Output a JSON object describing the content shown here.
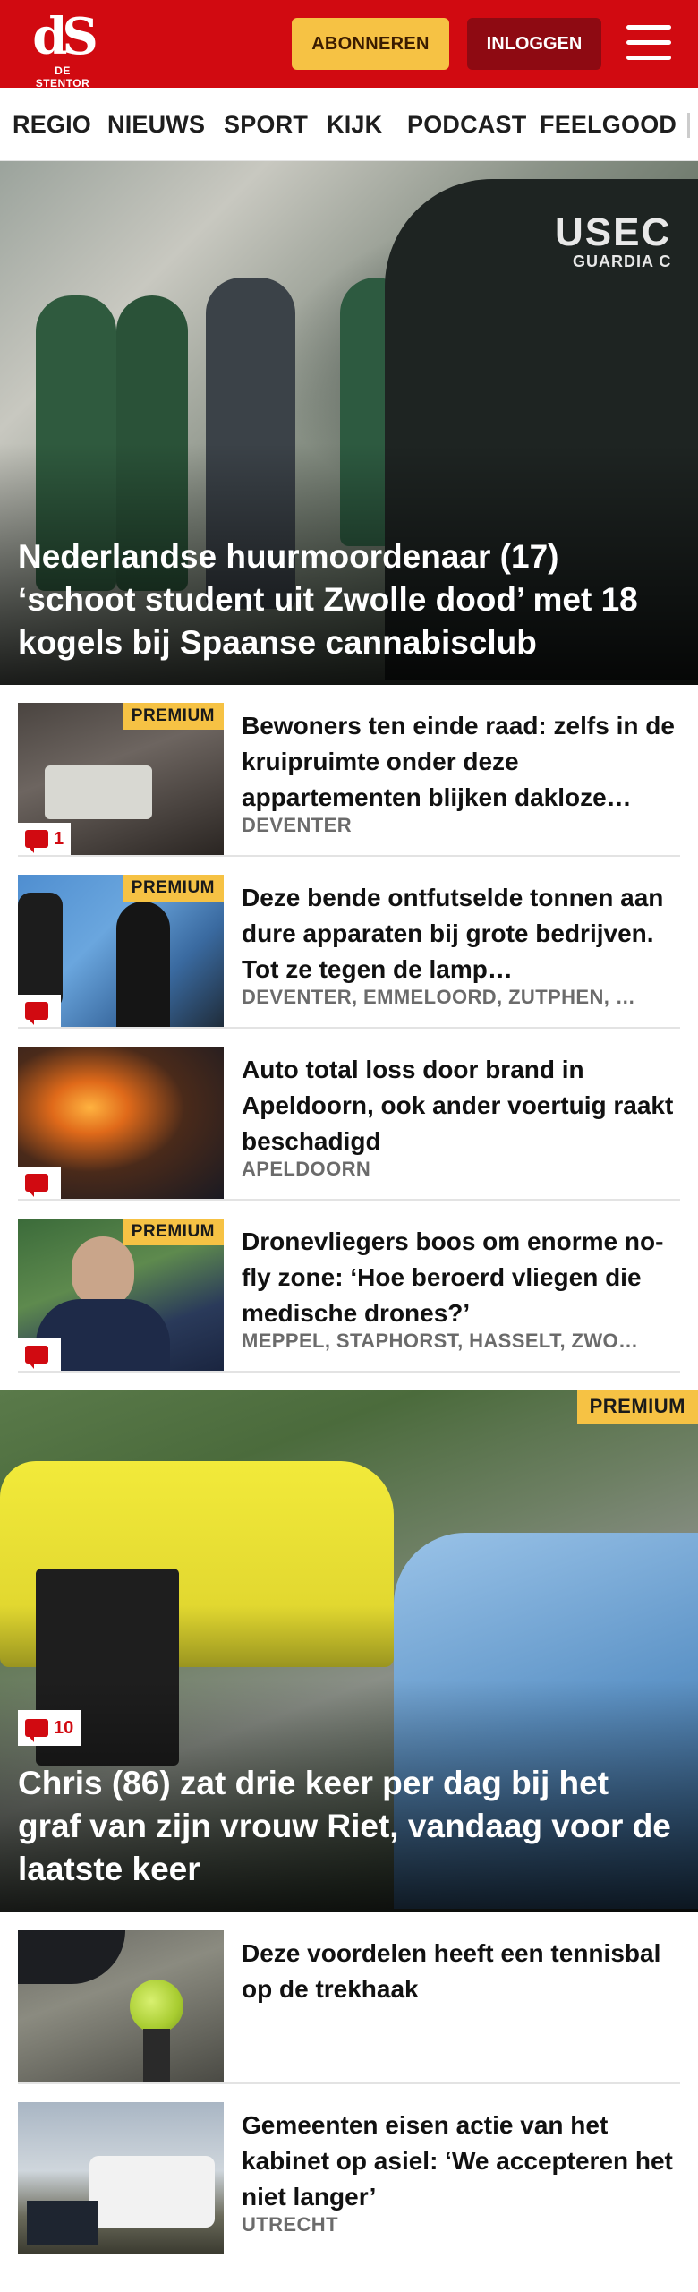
{
  "header": {
    "logo_mark": "dS",
    "logo_name": "DE STENTOR",
    "subscribe_label": "ABONNEREN",
    "login_label": "INLOGGEN",
    "menu_icon": "hamburger-icon",
    "brand_color": "#d10a11",
    "accent_color": "#f6c244"
  },
  "nav": {
    "items": [
      "REGIO",
      "NIEUWS",
      "SPORT",
      "KIJK",
      "PODCAST",
      "FEELGOOD"
    ]
  },
  "hero": {
    "badge_line1": "USEC",
    "badge_line2": "GUARDIA C",
    "title": "Nederlandse huurmoordenaar (17) ‘schoot student uit Zwolle dood’ met 18 kogels bij Spaanse cannabisclub"
  },
  "articles": [
    {
      "title": "Bewoners ten einde raad: zelfs in de kruipruimte onder deze appartementen blijken dakloze…",
      "location": "DEVENTER",
      "premium": "PREMIUM",
      "comments": "1"
    },
    {
      "title": "Deze bende ontfutselde tonnen aan dure apparaten bij grote bedrijven. Tot ze tegen de lamp…",
      "location": "DEVENTER, EMMELOORD, ZUTPHEN, …",
      "premium": "PREMIUM",
      "comments": ""
    },
    {
      "title": "Auto total loss door brand in Apeldoorn, ook ander voertuig raakt beschadigd",
      "location": "APELDOORN",
      "premium": "",
      "comments": ""
    },
    {
      "title": "Dronevliegers boos om enorme no-fly zone: ‘Hoe beroerd vliegen die medische drones?’",
      "location": "MEPPEL, STAPHORST, HASSELT, ZWO…",
      "premium": "PREMIUM",
      "comments": ""
    }
  ],
  "feature": {
    "premium": "PREMIUM",
    "comments": "10",
    "title": "Chris (86) zat drie keer per dag bij het graf van zijn vrouw Riet, vandaag voor de laatste keer"
  },
  "articles2": [
    {
      "title": "Deze voordelen heeft een tennisbal op de trekhaak",
      "location": ""
    },
    {
      "title": "Gemeenten eisen actie van het kabinet op asiel: ‘We accepteren het niet langer’",
      "location": "UTRECHT"
    }
  ]
}
